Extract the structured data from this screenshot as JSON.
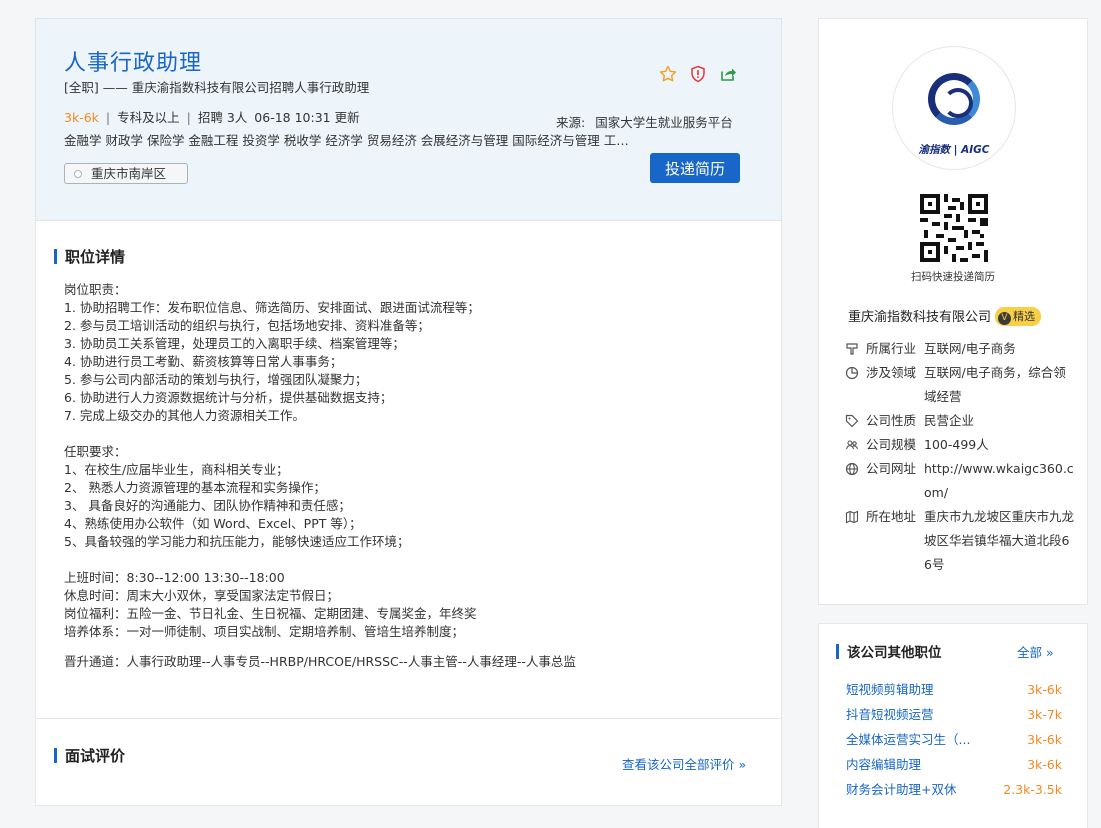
{
  "header": {
    "title": "人事行政助理",
    "subtitle": "[全职]  ——  重庆渝指数科技有限公司招聘人事行政助理",
    "salary": "3k-6k",
    "education": "专科及以上",
    "headcount": "招聘 3人",
    "updated": "06-18 10:31 更新",
    "source_label": "来源:",
    "source_value": "国家大学生就业服务平台",
    "majors": "金融学 财政学 保险学 金融工程 投资学 税收学 经济学 贸易经济 会展经济与管理 国际经济与管理 工商管理 市场营销 会计学",
    "location": "重庆市南岸区",
    "apply_label": "投递简历",
    "icons": [
      "star-icon",
      "report-icon",
      "share-icon"
    ]
  },
  "details": {
    "section_title": "职位详情",
    "lines": [
      "岗位职责：",
      "1. 协助招聘工作：发布职位信息、筛选简历、安排面试、跟进面试流程等；",
      "2. 参与员工培训活动的组织与执行，包括场地安排、资料准备等；",
      "3. 协助员工关系管理，处理员工的入离职手续、档案管理等；",
      "4. 协助进行员工考勤、薪资核算等日常人事事务；",
      "5. 参与公司内部活动的策划与执行，增强团队凝聚力；",
      "6. 协助进行人力资源数据统计与分析，提供基础数据支持；",
      "7. 完成上级交办的其他人力资源相关工作。",
      "",
      "任职要求：",
      "1、在校生/应届毕业生，商科相关专业；",
      "2、 熟悉人力资源管理的基本流程和实务操作；",
      "3、 具备良好的沟通能力、团队协作精神和责任感；",
      "4、熟练使用办公软件（如 Word、Excel、PPT 等）；",
      "5、具备较强的学习能力和抗压能力，能够快速适应工作环境；",
      "",
      "上班时间：8:30--12:00   13:30--18:00",
      "休息时间：周末大小双休，享受国家法定节假日；",
      "岗位福利：五险一金、节日礼金、生日祝福、定期团建、专属奖金，年终奖",
      "培养体系：一对一师徒制、项目实战制、定期培养制、管培生培养制度；"
    ],
    "promotion": "晋升通道：人事行政助理--人事专员--HRBP/HRCOE/HRSSC--人事主管--人事经理--人事总监"
  },
  "interview": {
    "section_title": "面试评价",
    "link_label": "查看该公司全部评价"
  },
  "company": {
    "logo_text": "渝指数 | AIGC",
    "qr_caption": "扫码快速投递简历",
    "name": "重庆渝指数科技有限公司",
    "badge": "精选",
    "badge_icon": "V",
    "info": [
      {
        "label": "所属行业",
        "value": "互联网/电子商务",
        "icon": "industry-icon"
      },
      {
        "label": "涉及领域",
        "value": "互联网/电子商务，综合领域经营",
        "icon": "domain-icon"
      },
      {
        "label": "公司性质",
        "value": "民营企业",
        "icon": "tag-icon"
      },
      {
        "label": "公司规模",
        "value": "100-499人",
        "icon": "people-icon"
      },
      {
        "label": "公司网址",
        "value": "http://www.wkaigc360.com/",
        "icon": "globe-icon"
      },
      {
        "label": "所在地址",
        "value": "重庆市九龙坡区重庆市九龙坡区华岩镇华福大道北段66号",
        "icon": "map-icon"
      }
    ]
  },
  "other_jobs": {
    "section_title": "该公司其他职位",
    "all_label": "全部",
    "items": [
      {
        "name": "短视频剪辑助理",
        "salary": "3k-6k"
      },
      {
        "name": "抖音短视频运营",
        "salary": "3k-7k"
      },
      {
        "name": "全媒体运营实习生（...",
        "salary": "3k-6k"
      },
      {
        "name": "内容编辑助理",
        "salary": "3k-6k"
      },
      {
        "name": "财务会计助理+双休",
        "salary": "2.3k-3.5k"
      }
    ]
  },
  "colors": {
    "accent": "#1766c8",
    "salary": "#f08a24",
    "header_bg": "#edf5fa",
    "badge": "#f7d048"
  }
}
